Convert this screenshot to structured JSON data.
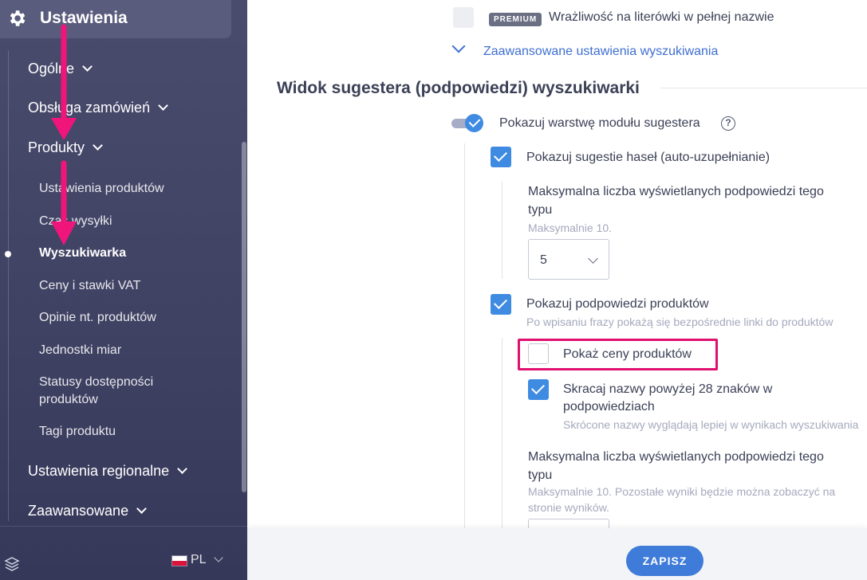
{
  "sidebar": {
    "title": "Ustawienia",
    "items": [
      {
        "label": "Ogólne"
      },
      {
        "label": "Obsługa zamówień"
      },
      {
        "label": "Produkty"
      },
      {
        "label": "Ustawienia regionalne"
      },
      {
        "label": "Zaawansowane"
      }
    ],
    "sub_items": [
      {
        "label": "Ustawienia produktów"
      },
      {
        "label": "Czas wysyłki"
      },
      {
        "label": "Wyszukiwarka",
        "active": true
      },
      {
        "label": "Ceny i stawki VAT"
      },
      {
        "label": "Opinie nt. produktów"
      },
      {
        "label": "Jednostki miar"
      },
      {
        "label": "Statusy dostępności produktów"
      },
      {
        "label": "Tagi produktu"
      }
    ],
    "footer": {
      "lang": "PL"
    }
  },
  "main": {
    "typo_label": "Wrażliwość na literówki w pełnej nazwie",
    "premium_badge": "PREMIUM",
    "advanced_link": "Zaawansowane ustawienia wyszukiwania",
    "section_title": "Widok sugestera (podpowiedzi) wyszukiwarki",
    "suggester_toggle_label": "Pokazuj warstwę modułu sugestera",
    "suggester_help": "?",
    "show_suggestions_label": "Pokazuj sugestie haseł (auto-uzupełnianie)",
    "max_suggestions_label_1": "Maksymalna liczba wyświetlanych podpowiedzi tego",
    "max_suggestions_label_2": "typu",
    "max_suggestions_hint": "Maksymalnie 10.",
    "max_suggestions_value": "5",
    "show_products_label": "Pokazuj podpowiedzi produktów",
    "show_products_hint": "Po wpisaniu frazy pokażą się bezpośrednie linki do produktów",
    "show_prices_label": "Pokaż ceny produktów",
    "shorten_label_1": "Skracaj nazwy powyżej 28 znaków w",
    "shorten_label_2": "podpowiedziach",
    "shorten_hint": "Skrócone nazwy wyglądają lepiej w wynikach wyszukiwania",
    "max_products_label_1": "Maksymalna liczba wyświetlanych podpowiedzi tego",
    "max_products_label_2": "typu",
    "max_products_hint_1": "Maksymalnie 10. Pozostałe wyniki będzie można zobaczyć na",
    "max_products_hint_2": "stronie wyników.",
    "save_label": "ZAPISZ"
  },
  "colors": {
    "accent": "#3f8be2",
    "highlight": "#e0106f",
    "sidebar_bg": "#434566",
    "arrow": "#f0157a"
  }
}
